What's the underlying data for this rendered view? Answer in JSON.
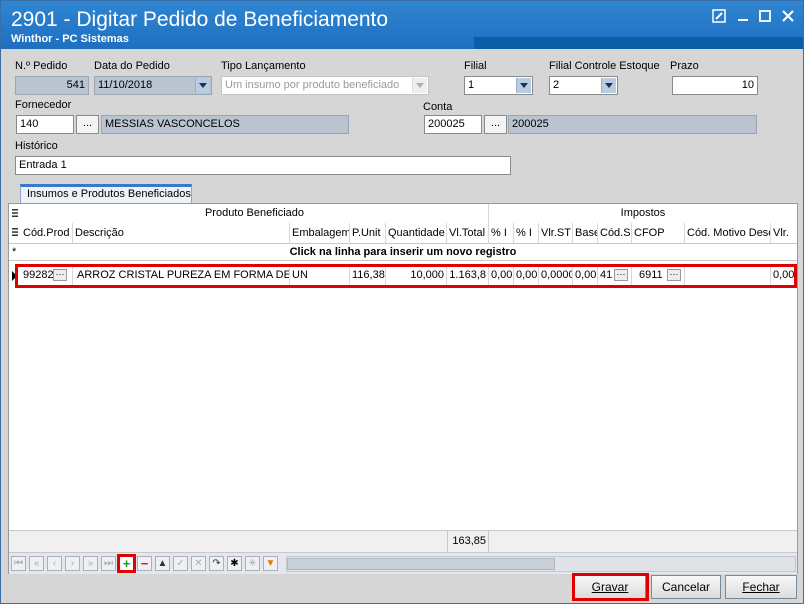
{
  "window": {
    "title": "2901 - Digitar Pedido de Beneficiamento",
    "subtitle": "Winthor - PC Sistemas",
    "controls": [
      "edit-icon",
      "minimize-icon",
      "maximize-icon",
      "close-icon"
    ]
  },
  "form": {
    "pedido": {
      "label": "N.º Pedido",
      "value": "541"
    },
    "data": {
      "label": "Data do Pedido",
      "value": "11/10/2018"
    },
    "tipo": {
      "label": "Tipo Lançamento",
      "value": "Um insumo por produto beneficiado"
    },
    "filial": {
      "label": "Filial",
      "value": "1"
    },
    "filial_estoque": {
      "label": "Filial Controle Estoque",
      "value": "2"
    },
    "prazo": {
      "label": "Prazo",
      "value": "10"
    },
    "fornecedor": {
      "label": "Fornecedor",
      "code": "140",
      "ellipsis": "...",
      "name": "MESSIAS VASCONCELOS"
    },
    "conta": {
      "label": "Conta",
      "code": "200025",
      "ellipsis": "...",
      "name": "200025"
    },
    "historico": {
      "label": "Histórico",
      "value": "Entrada 1"
    }
  },
  "tab": {
    "label": "Insumos e Produtos Beneficiados"
  },
  "grid": {
    "group_headers": {
      "produto": "Produto Beneficiado",
      "impostos": "Impostos"
    },
    "columns": [
      "Cód.Prod",
      "Descrição",
      "Embalagem",
      "P.Unit",
      "Quantidade",
      "Vl.Total",
      "% I",
      "% I",
      "Vlr.ST",
      "Base",
      "Cód.S",
      "CFOP",
      "Cód. Motivo Desc",
      "Vlr."
    ],
    "new_row_text": "Click na linha para inserir um novo registro",
    "row": {
      "cod_prod": "99282",
      "descricao": "ARROZ  CRISTAL PUREZA EM FORMA DE GR",
      "embalagem": "UN",
      "p_unit": "116,38",
      "quantidade": "10,000",
      "vl_total": "1.163,8",
      "pct1": "0,00",
      "pct2": "0,00",
      "vlr_st": "0,0000",
      "base": "0,00",
      "cod_s": "41",
      "cfop": "6911",
      "cod_motivo": "",
      "vlr": "0,00"
    },
    "footer_total": "163,85"
  },
  "buttons": {
    "gravar": "Gravar",
    "cancelar": "Cancelar",
    "fechar": "Fechar"
  },
  "colors": {
    "title_bar": "#1e6fc0",
    "highlight": "#e00000",
    "readonly": "#b9c4d0"
  }
}
